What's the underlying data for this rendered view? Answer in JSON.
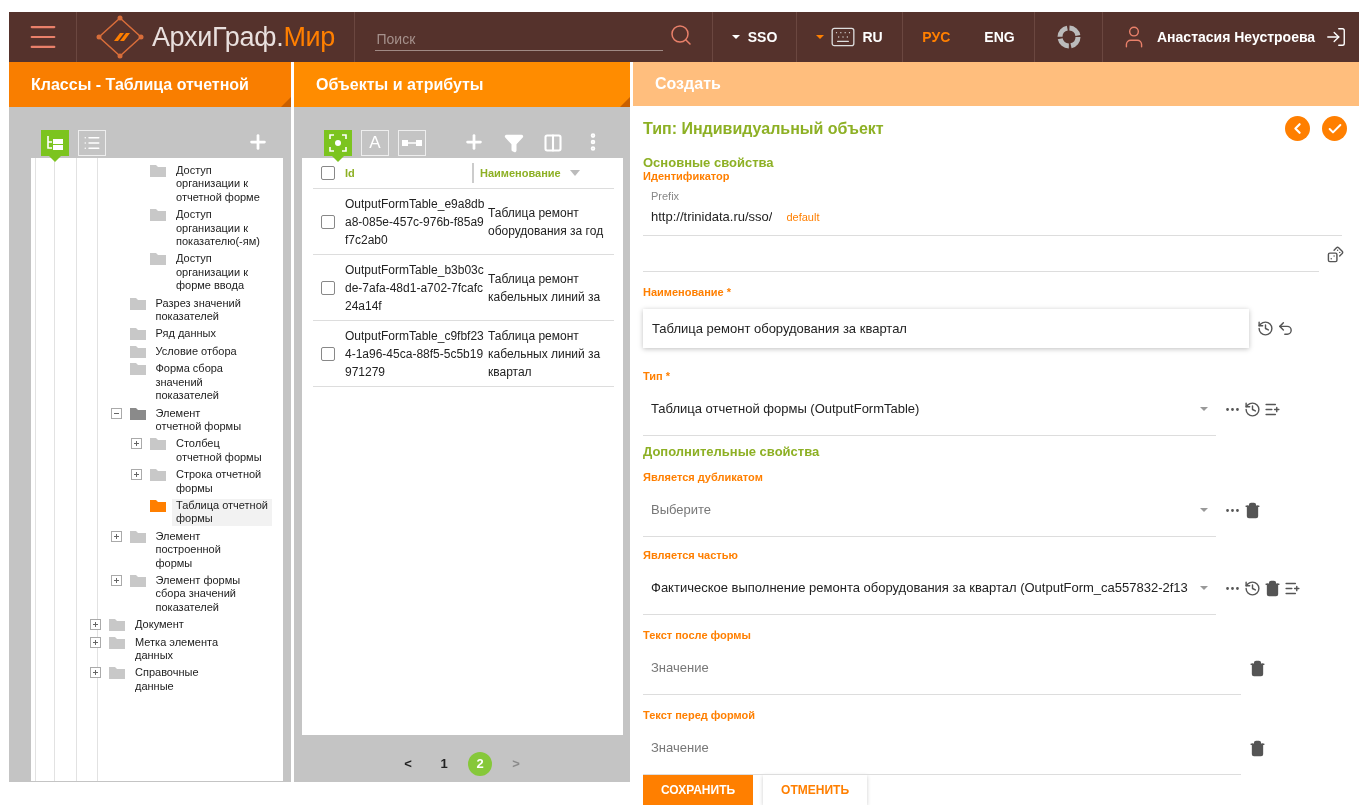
{
  "header": {
    "brand_main": "АрхиГраф.",
    "brand_accent": "Мир",
    "search": {
      "placeholder": "Поиск"
    },
    "repository": {
      "label": "SSO"
    },
    "keyboard": {
      "label": "RU"
    },
    "languages": [
      {
        "label": "РУС",
        "selected": true
      },
      {
        "label": "ENG",
        "selected": false
      }
    ],
    "user": "Анастасия Неустроева"
  },
  "classes_panel": {
    "title": "Классы - Таблица отчетной",
    "views": [
      {
        "kind": "tree",
        "selected": true
      },
      {
        "kind": "list",
        "selected": false
      }
    ],
    "tree": [
      {
        "children": [
          {
            "children": [
              {
                "label": "Доступ организации к отчетной форме",
                "selected": false
              },
              {
                "label": "Доступ организации к показателю(-ям)",
                "selected": false
              },
              {
                "label": "Доступ организации к форме ввода",
                "selected": false
              }
            ]
          },
          {
            "label": "Разрез значений показателей",
            "selected": false
          },
          {
            "label": "Ряд данных",
            "selected": false
          },
          {
            "label": "Условие отбора",
            "selected": false
          },
          {
            "label": "Форма сбора значений показателей",
            "selected": false
          },
          {
            "label": "Элемент отчетной формы",
            "selected": false,
            "expanded": true,
            "children": [
              {
                "label": "Столбец отчетной формы",
                "selected": false,
                "expanded": false
              },
              {
                "label": "Строка отчетной формы",
                "selected": false,
                "expanded": false
              },
              {
                "label": "Таблица отчетной формы",
                "selected": true
              }
            ]
          },
          {
            "label": "Элемент построенной формы",
            "selected": false,
            "expanded": false
          },
          {
            "label": "Элемент формы сбора значений показателей",
            "selected": false,
            "expanded": false
          }
        ]
      },
      {
        "label": "Документ",
        "selected": false,
        "expanded": false
      },
      {
        "label": "Метка элемента данных",
        "selected": false,
        "expanded": false
      },
      {
        "label": "Справочные данные",
        "selected": false,
        "expanded": false
      }
    ]
  },
  "objects_panel": {
    "title": "Объекты и атрибуты",
    "modes": [
      {
        "kind": "individual",
        "selected": true
      },
      {
        "kind": "attribute",
        "label": "A",
        "selected": false
      },
      {
        "kind": "relation",
        "selected": false
      }
    ],
    "columns": [
      "Id",
      "Наименование"
    ],
    "all_checked": false,
    "rows": [
      {
        "id": "OutputFormTable_e9a8dba8-085e-457c-976b-f85a9f7c2ab0",
        "name": "Таблица ремонт оборудования за год",
        "checked": false
      },
      {
        "id": "OutputFormTable_b3b03cde-7afa-48d1-a702-7fcafc24a14f",
        "name": "Таблица ремонт кабельных линий за",
        "checked": false
      },
      {
        "id": "OutputFormTable_c9fbf234-1a96-45ca-88f5-5c5b19971279",
        "name": "Таблица ремонт кабельных линий за квартал",
        "checked": false
      }
    ],
    "pagination": {
      "prev": {
        "label": "<",
        "disabled": false
      },
      "pages": [
        {
          "label": "1",
          "selected": false
        },
        {
          "label": "2",
          "selected": true
        }
      ],
      "next": {
        "label": ">",
        "disabled": true
      }
    }
  },
  "create_panel": {
    "title": "Создать",
    "heading": "Тип: Индивидуальный объект",
    "sections": [
      {
        "title": "Основные свойства",
        "fields": [
          {
            "kind": "prefix",
            "label": "Идентификатор",
            "prefix_label": "Prefix",
            "value": "http://trinidata.ru/sso/",
            "tag": "default",
            "actions": [
              {
                "kind": "dice"
              }
            ]
          },
          {
            "kind": "card",
            "label": "Наименование *",
            "value": "Таблица ремонт оборудования за квартал",
            "actions": [
              {
                "kind": "history"
              },
              {
                "kind": "undo"
              }
            ]
          },
          {
            "kind": "select",
            "label": "Тип *",
            "value": "Таблица отчетной формы (OutputFormTable)",
            "actions": [
              {
                "kind": "more"
              },
              {
                "kind": "history"
              },
              {
                "kind": "add-list"
              }
            ]
          }
        ]
      },
      {
        "title": "Дополнительные свойства",
        "fields": [
          {
            "kind": "select",
            "label": "Является дубликатом",
            "placeholder": "Выберите",
            "actions": [
              {
                "kind": "more"
              },
              {
                "kind": "trash"
              }
            ]
          },
          {
            "kind": "select",
            "label": "Является частью",
            "value": "Фактическое выполнение ремонта оборудования за квартал (OutputForm_ca557832-2f13",
            "actions": [
              {
                "kind": "more"
              },
              {
                "kind": "history"
              },
              {
                "kind": "trash"
              },
              {
                "kind": "add-list"
              }
            ]
          },
          {
            "kind": "text",
            "label": "Текст после формы",
            "placeholder": "Значение",
            "actions": [
              {
                "kind": "trash"
              }
            ]
          },
          {
            "kind": "text",
            "label": "Текст перед формой",
            "placeholder": "Значение",
            "actions": [
              {
                "kind": "trash"
              }
            ]
          }
        ]
      }
    ],
    "buttons": [
      {
        "kind": "primary",
        "label": "СОХРАНИТЬ"
      },
      {
        "kind": "secondary",
        "label": "ОТМЕНИТЬ"
      }
    ]
  }
}
